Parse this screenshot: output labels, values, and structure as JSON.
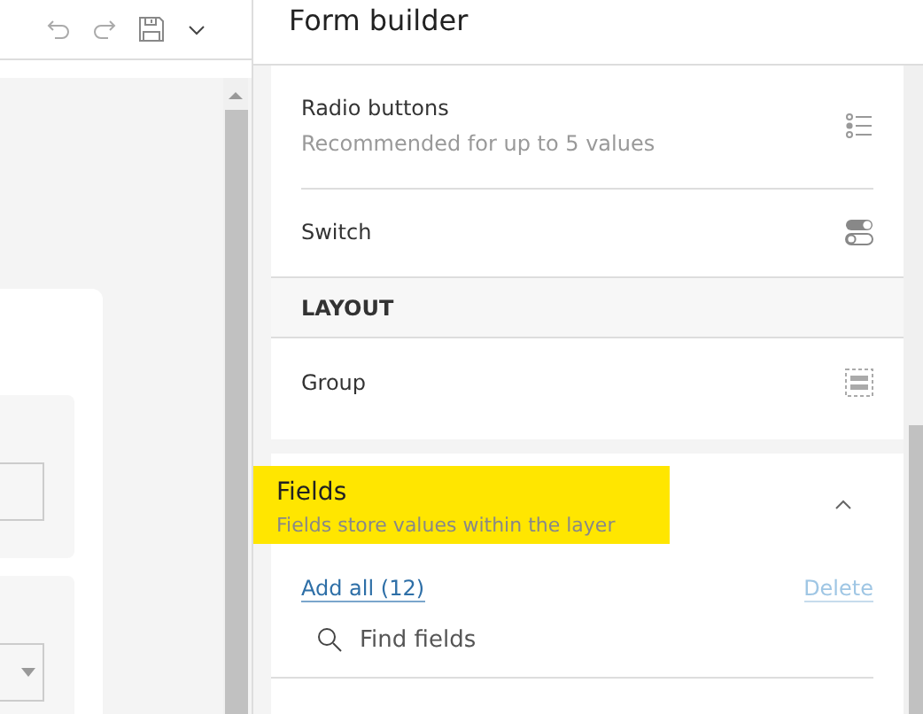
{
  "left_pane": {
    "toolbar": {
      "undo_disabled": true,
      "redo_disabled": true
    }
  },
  "panel": {
    "title": "Form builder",
    "elements": [
      {
        "kind": "radio",
        "label": "Radio buttons",
        "description": "Recommended for up to 5 values"
      },
      {
        "kind": "switch",
        "label": "Switch"
      },
      {
        "kind": "header",
        "label": "LAYOUT"
      },
      {
        "kind": "group",
        "label": "Group"
      }
    ],
    "fields_section": {
      "title": "Fields",
      "subtitle": "Fields store values within the layer",
      "expanded": true,
      "highlighted": true,
      "add_all": "Add all (12)",
      "delete": {
        "label": "Delete",
        "disabled": true
      },
      "search": {
        "placeholder": "Find fields"
      }
    }
  }
}
